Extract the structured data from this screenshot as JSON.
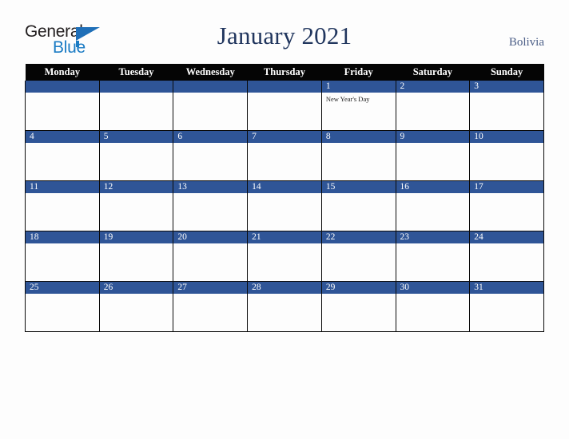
{
  "brand": {
    "line1": "General",
    "line2": "Blue",
    "triangle_color": "#1f6fb8",
    "text_color": "#231f20",
    "accent_color": "#1a7bc4"
  },
  "header": {
    "title": "January 2021",
    "region": "Bolivia",
    "title_color": "#21365e",
    "region_color": "#4a5d86"
  },
  "calendar": {
    "month": "January",
    "year": "2021",
    "week_start": "Monday",
    "header_bg": "#050505",
    "daynum_bg": "#2f5597",
    "cell_bg": "#fdfdfd",
    "border_color": "#0a0a0a",
    "weekdays": [
      "Monday",
      "Tuesday",
      "Wednesday",
      "Thursday",
      "Friday",
      "Saturday",
      "Sunday"
    ],
    "weeks": [
      [
        {
          "day": "",
          "events": []
        },
        {
          "day": "",
          "events": []
        },
        {
          "day": "",
          "events": []
        },
        {
          "day": "",
          "events": []
        },
        {
          "day": "1",
          "events": [
            "New Year's Day"
          ]
        },
        {
          "day": "2",
          "events": []
        },
        {
          "day": "3",
          "events": []
        }
      ],
      [
        {
          "day": "4",
          "events": []
        },
        {
          "day": "5",
          "events": []
        },
        {
          "day": "6",
          "events": []
        },
        {
          "day": "7",
          "events": []
        },
        {
          "day": "8",
          "events": []
        },
        {
          "day": "9",
          "events": []
        },
        {
          "day": "10",
          "events": []
        }
      ],
      [
        {
          "day": "11",
          "events": []
        },
        {
          "day": "12",
          "events": []
        },
        {
          "day": "13",
          "events": []
        },
        {
          "day": "14",
          "events": []
        },
        {
          "day": "15",
          "events": []
        },
        {
          "day": "16",
          "events": []
        },
        {
          "day": "17",
          "events": []
        }
      ],
      [
        {
          "day": "18",
          "events": []
        },
        {
          "day": "19",
          "events": []
        },
        {
          "day": "20",
          "events": []
        },
        {
          "day": "21",
          "events": []
        },
        {
          "day": "22",
          "events": []
        },
        {
          "day": "23",
          "events": []
        },
        {
          "day": "24",
          "events": []
        }
      ],
      [
        {
          "day": "25",
          "events": []
        },
        {
          "day": "26",
          "events": []
        },
        {
          "day": "27",
          "events": []
        },
        {
          "day": "28",
          "events": []
        },
        {
          "day": "29",
          "events": []
        },
        {
          "day": "30",
          "events": []
        },
        {
          "day": "31",
          "events": []
        }
      ]
    ]
  }
}
